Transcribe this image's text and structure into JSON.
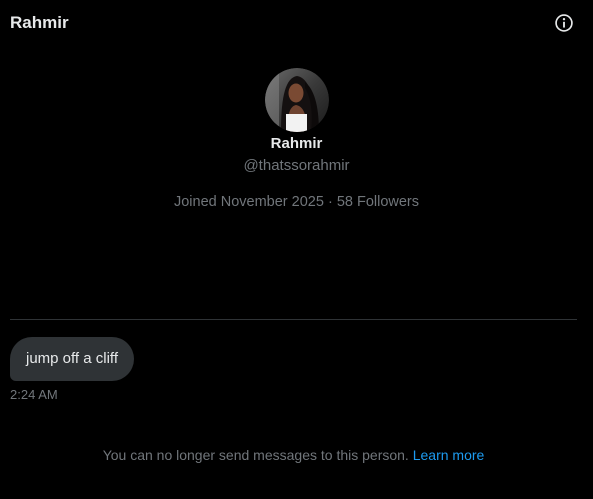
{
  "header": {
    "title": "Rahmir",
    "info_icon": "info-circle-icon"
  },
  "profile": {
    "name": "Rahmir",
    "handle": "@thatssorahmir",
    "joined": "Joined November 2025",
    "separator": "·",
    "followers": "58 Followers",
    "avatar_icon": "profile-photo"
  },
  "messages": [
    {
      "text": "jump off a cliff",
      "time": "2:24 AM"
    }
  ],
  "footer": {
    "notice": "You can no longer send messages to this person.",
    "link_label": "Learn more"
  },
  "colors": {
    "background": "#000000",
    "primary_text": "#e7e9ea",
    "secondary_text": "#71767b",
    "bubble": "#2f3336",
    "divider": "#2f3336",
    "link": "#1d9bf0"
  }
}
